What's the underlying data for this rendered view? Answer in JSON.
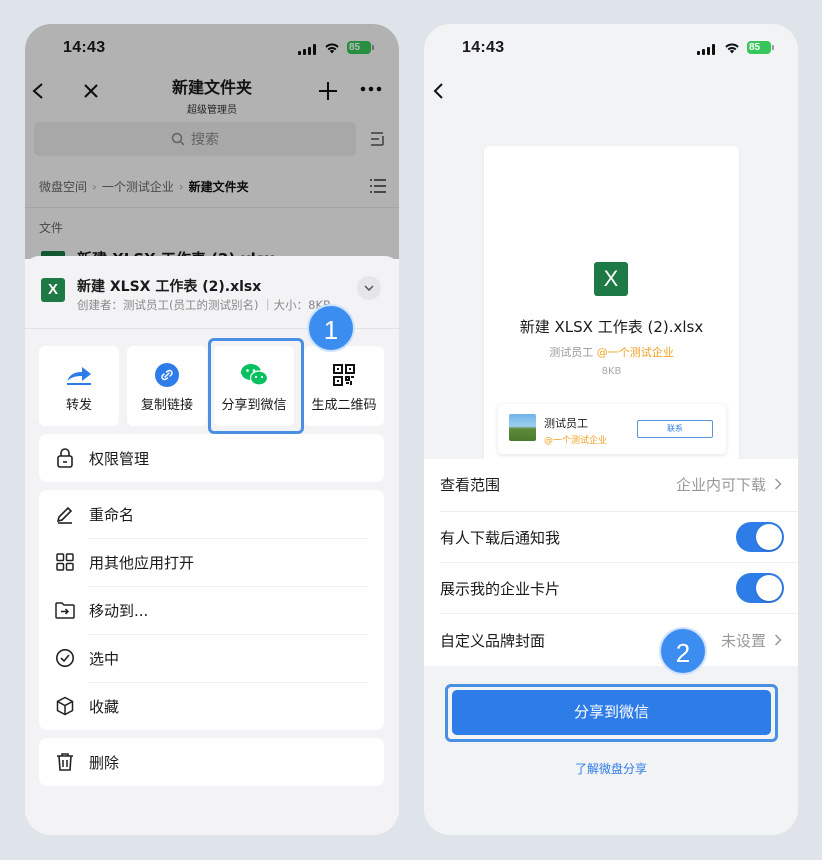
{
  "status": {
    "time": "14:43",
    "battery": "85"
  },
  "left": {
    "nav": {
      "title": "新建文件夹",
      "subtitle": "超级管理员"
    },
    "search": {
      "placeholder": "搜索"
    },
    "breadcrumb": {
      "items": [
        "微盘空间",
        "一个测试企业",
        "新建文件夹"
      ]
    },
    "section_label": "文件",
    "peek_text": "新建 XLSX 工作表 (2).xlsx",
    "file": {
      "icon_letter": "X",
      "name": "新建 XLSX 工作表 (2).xlsx",
      "meta": "创建者：测试员工(员工的测试别名) ｜大小：8KB"
    },
    "actions": [
      {
        "label": "转发",
        "icon": "forward-icon"
      },
      {
        "label": "复制链接",
        "icon": "link-icon"
      },
      {
        "label": "分享到微信",
        "icon": "wechat-icon"
      },
      {
        "label": "生成二维码",
        "icon": "qrcode-icon"
      }
    ],
    "permission": "权限管理",
    "menu": [
      {
        "label": "重命名",
        "icon": "pencil-icon"
      },
      {
        "label": "用其他应用打开",
        "icon": "grid-icon"
      },
      {
        "label": "移动到...",
        "icon": "move-folder-icon"
      },
      {
        "label": "选中",
        "icon": "check-circle-icon"
      },
      {
        "label": "收藏",
        "icon": "cube-icon"
      }
    ],
    "delete": "删除",
    "step_badge": "1"
  },
  "right": {
    "preview": {
      "icon_letter": "X",
      "name": "新建 XLSX 工作表 (2).xlsx",
      "owner": "测试员工",
      "company": "@一个测试企业",
      "size": "8KB",
      "card_name": "测试员工",
      "card_company": "@一个测试企业",
      "card_button": "联系"
    },
    "settings": [
      {
        "label": "查看范围",
        "value": "企业内可下载"
      },
      {
        "label": "有人下载后通知我",
        "toggle": true
      },
      {
        "label": "展示我的企业卡片",
        "toggle": true
      },
      {
        "label": "自定义品牌封面",
        "value": "未设置"
      }
    ],
    "share_button": "分享到微信",
    "learn_link": "了解微盘分享",
    "step_badge": "2"
  },
  "colors": {
    "accent": "#2e7ce8",
    "excel": "#1d7a44",
    "wechat": "#07c160",
    "highlight": "#4a90e2",
    "orange": "#f0a020"
  }
}
